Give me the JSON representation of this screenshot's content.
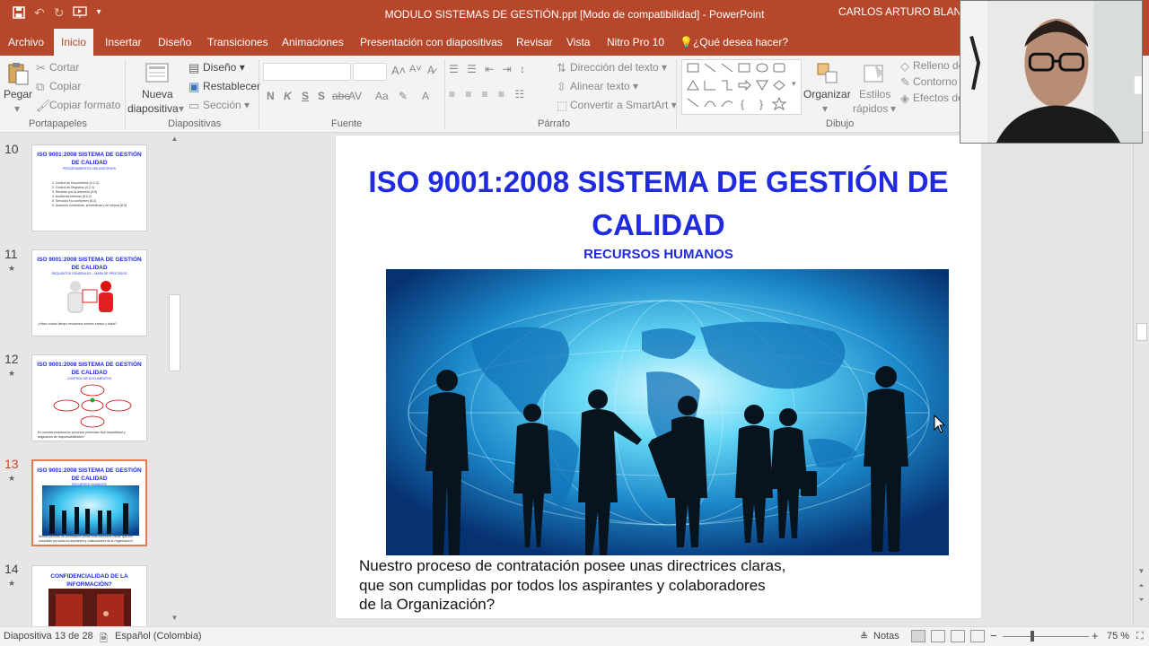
{
  "window": {
    "title": "MODULO SISTEMAS DE GESTIÓN.ppt [Modo de compatibilidad]  -  PowerPoint",
    "user": "CARLOS ARTURO BLANDO"
  },
  "qat": {
    "save": "save-icon",
    "undo": "undo-icon",
    "redo": "redo-icon",
    "start": "present-icon",
    "customize": "▾"
  },
  "tabs": [
    "Archivo",
    "Inicio",
    "Insertar",
    "Diseño",
    "Transiciones",
    "Animaciones",
    "Presentación con diapositivas",
    "Revisar",
    "Vista",
    "Nitro Pro 10"
  ],
  "tell_me": "¿Qué desea hacer?",
  "ribbon": {
    "clipboard": {
      "paste": "Pegar",
      "cut": "Cortar",
      "copy": "Copiar",
      "format_painter": "Copiar formato",
      "group": "Portapapeles"
    },
    "slides": {
      "new_slide_1": "Nueva",
      "new_slide_2": "diapositiva",
      "layout": "Diseño",
      "reset": "Restablecer",
      "section": "Sección",
      "group": "Diapositivas"
    },
    "font": {
      "group": "Fuente",
      "bold": "N",
      "italic": "K",
      "underline": "S",
      "strike": "S",
      "shadow": "abc",
      "spacing": "AV",
      "case": "Aa",
      "color": "A"
    },
    "paragraph": {
      "group": "Párrafo",
      "text_direction": "Dirección del texto",
      "align_text": "Alinear texto",
      "smartart": "Convertir a SmartArt"
    },
    "drawing": {
      "group": "Dibujo",
      "arrange": "Organizar",
      "quick_styles_1": "Estilos",
      "quick_styles_2": "rápidos",
      "fill": "Relleno de",
      "outline": "Contorno",
      "effects": "Efectos de"
    }
  },
  "thumbnails": [
    {
      "num": "10",
      "star": "",
      "title": "ISO 9001:2008 SISTEMA DE GESTIÓN DE CALIDAD",
      "subtitle": "PROCEDIMIENTOS OBLIGATORIOS",
      "body": "1. Control de Documentos (4.2.3)\n2. Control de Registros (4.2.4)\n3. Revisión por la dirección (5.6)\n4. Auditorías internas (8.2.2)\n5. Servicios No conformes (8.3)\n6. Acciones correctivas, preventivas y de mejora (8.5)"
    },
    {
      "num": "11",
      "star": "★",
      "title": "ISO 9001:2008 SISTEMA DE GESTIÓN DE CALIDAD",
      "subtitle": "REQUISITOS GENERALES – MAPA DE PROCESOS",
      "body": "¿Hace cuánto tiempo revisamos nuestro estado y salud?"
    },
    {
      "num": "12",
      "star": "★",
      "title": "ISO 9001:2008 SISTEMA DE GESTIÓN DE CALIDAD",
      "subtitle": "CONTROL DE DOCUMENTOS",
      "body": "En nuestra empresa los procesos presentan facil trazabilidad y asignación de responsabilidades?"
    },
    {
      "num": "13",
      "star": "★",
      "title": "ISO 9001:2008 SISTEMA DE GESTIÓN DE CALIDAD",
      "subtitle": "RECURSOS HUMANOS",
      "body": "Nuestro proceso de contratación posee unas directrices claras, que son cumplidas por todos los aspirantes y colaboradores de la Organización?"
    },
    {
      "num": "14",
      "star": "★",
      "title": "CONFIDENCIALIDAD DE LA INFORMACIÓN?",
      "subtitle": "",
      "body": ""
    }
  ],
  "slide": {
    "title": "ISO 9001:2008 SISTEMA DE GESTIÓN DE CALIDAD",
    "subtitle": "RECURSOS HUMANOS",
    "body": "Nuestro proceso de contratación posee unas directrices claras,\nque son cumplidas por todos los aspirantes y colaboradores\nde la Organización?"
  },
  "status": {
    "slide_info": "Diapositiva 13 de 28",
    "language": "Español (Colombia)",
    "notes": "Notas",
    "zoom": "75 %",
    "zoom_minus": "−",
    "zoom_plus": "+"
  },
  "colors": {
    "accent": "#b7472a",
    "slide_title": "#1f2bdc",
    "active_thumb": "#e07b53"
  }
}
